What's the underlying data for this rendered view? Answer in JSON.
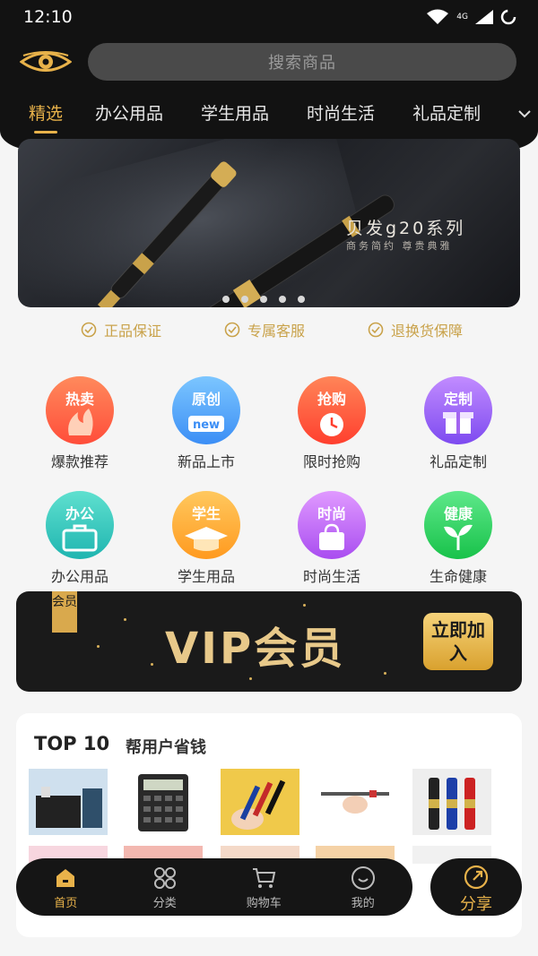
{
  "status": {
    "time": "12:10",
    "network": "4G"
  },
  "search": {
    "placeholder": "搜索商品"
  },
  "tabs": [
    "精选",
    "办公用品",
    "学生用品",
    "时尚生活",
    "礼品定制"
  ],
  "banner": {
    "title": "贝发g20系列",
    "subtitle": "商务简约  尊贵典雅",
    "slides": 5
  },
  "guarantees": [
    "正品保证",
    "专属客服",
    "退换货保障"
  ],
  "categories": [
    {
      "badge": "热卖",
      "label": "爆款推荐",
      "color": "#ff6b45"
    },
    {
      "badge": "原创",
      "label": "新品上市",
      "color": "#4aa8f5"
    },
    {
      "badge": "抢购",
      "label": "限时抢购",
      "color": "#ff5a3c"
    },
    {
      "badge": "定制",
      "label": "礼品定制",
      "color": "#a365f0"
    },
    {
      "badge": "办公",
      "label": "办公用品",
      "color": "#2ec9c0"
    },
    {
      "badge": "学生",
      "label": "学生用品",
      "color": "#ffb13a"
    },
    {
      "badge": "时尚",
      "label": "时尚生活",
      "color": "#c36cf2"
    },
    {
      "badge": "健康",
      "label": "生命健康",
      "color": "#2ed15c"
    }
  ],
  "vip": {
    "tag": "会员",
    "title": "VIP会员",
    "join": "立即加入"
  },
  "top10": {
    "title": "TOP 10",
    "subtitle": "帮用户省钱"
  },
  "nav": [
    "首页",
    "分类",
    "购物车",
    "我的"
  ],
  "share": "分享",
  "colors": {
    "accent": "#e8b24a",
    "dark": "#121212"
  }
}
